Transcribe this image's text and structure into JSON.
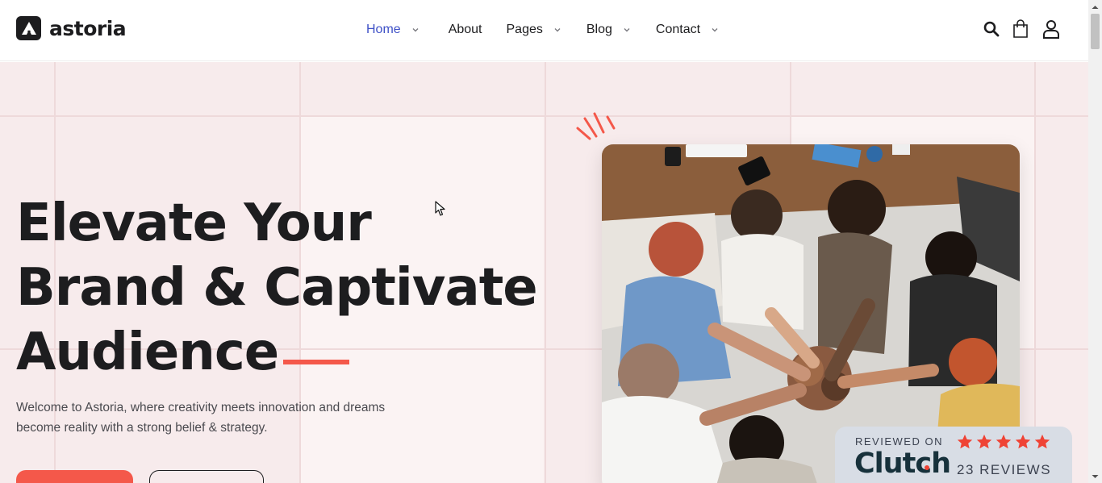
{
  "brand": {
    "name": "astoria"
  },
  "nav": {
    "items": [
      {
        "label": "Home",
        "has_dropdown": true,
        "active": true
      },
      {
        "label": "About",
        "has_dropdown": false,
        "active": false
      },
      {
        "label": "Pages",
        "has_dropdown": true,
        "active": false
      },
      {
        "label": "Blog",
        "has_dropdown": true,
        "active": false
      },
      {
        "label": "Contact",
        "has_dropdown": true,
        "active": false
      }
    ]
  },
  "header_icons": [
    "search-icon",
    "shopping-bag-icon",
    "user-icon"
  ],
  "hero": {
    "headline_lines": [
      "Elevate Your",
      "Brand & Captivate",
      "Audience"
    ],
    "intro": "Welcome to Astoria, where creativity meets innovation and dreams become reality with a strong belief & strategy."
  },
  "clutch": {
    "reviewed_on": "REVIEWED ON",
    "logo": "Clutch",
    "rating_stars": 5,
    "reviews": "23 REVIEWS"
  },
  "colors": {
    "accent": "#f4584a",
    "nav_active": "#3f51c7",
    "text_dark": "#1d1d1f",
    "hero_bg": "#f7ebec",
    "clutch_star": "#ef4335"
  }
}
